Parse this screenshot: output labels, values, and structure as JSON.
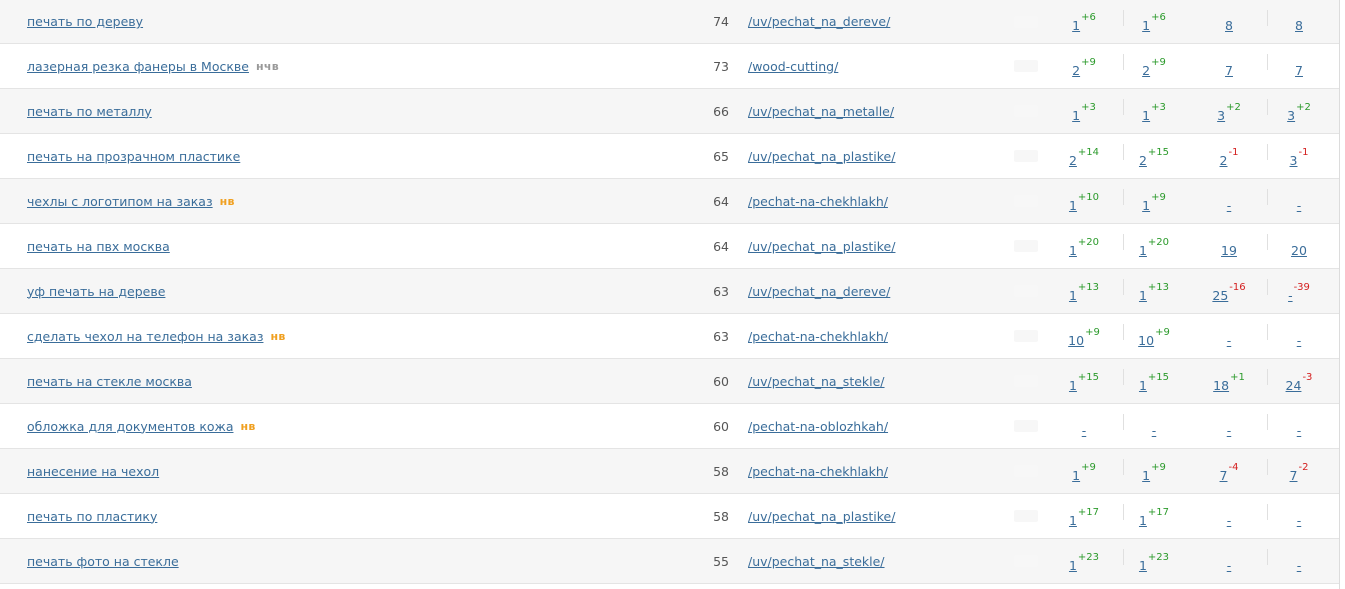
{
  "rows": [
    {
      "keyword": "печать по дереву",
      "badge": "",
      "badge_type": "",
      "freq": "74",
      "url": "/uv/pechat_na_dereve/",
      "p1": "1",
      "c1": "+6",
      "p2": "1",
      "c2": "+6",
      "p3": "8",
      "c3": "",
      "p4": "8",
      "c4": ""
    },
    {
      "keyword": "лазерная резка фанеры в Москве",
      "badge": "нчв",
      "badge_type": "nchv",
      "freq": "73",
      "url": "/wood-cutting/",
      "p1": "2",
      "c1": "+9",
      "p2": "2",
      "c2": "+9",
      "p3": "7",
      "c3": "",
      "p4": "7",
      "c4": ""
    },
    {
      "keyword": "печать по металлу",
      "badge": "",
      "badge_type": "",
      "freq": "66",
      "url": "/uv/pechat_na_metalle/",
      "p1": "1",
      "c1": "+3",
      "p2": "1",
      "c2": "+3",
      "p3": "3",
      "c3": "+2",
      "p4": "3",
      "c4": "+2"
    },
    {
      "keyword": "печать на прозрачном пластике",
      "badge": "",
      "badge_type": "",
      "freq": "65",
      "url": "/uv/pechat_na_plastike/",
      "p1": "2",
      "c1": "+14",
      "p2": "2",
      "c2": "+15",
      "p3": "2",
      "c3": "-1",
      "p4": "3",
      "c4": "-1"
    },
    {
      "keyword": "чехлы с логотипом на заказ",
      "badge": "нв",
      "badge_type": "nv",
      "freq": "64",
      "url": "/pechat-na-chekhlakh/",
      "p1": "1",
      "c1": "+10",
      "p2": "1",
      "c2": "+9",
      "p3": "-",
      "c3": "",
      "p4": "-",
      "c4": ""
    },
    {
      "keyword": "печать на пвх москва",
      "badge": "",
      "badge_type": "",
      "freq": "64",
      "url": "/uv/pechat_na_plastike/",
      "p1": "1",
      "c1": "+20",
      "p2": "1",
      "c2": "+20",
      "p3": "19",
      "c3": "",
      "p4": "20",
      "c4": ""
    },
    {
      "keyword": "уф печать на дереве",
      "badge": "",
      "badge_type": "",
      "freq": "63",
      "url": "/uv/pechat_na_dereve/",
      "p1": "1",
      "c1": "+13",
      "p2": "1",
      "c2": "+13",
      "p3": "25",
      "c3": "-16",
      "p4": "-",
      "c4": "-39"
    },
    {
      "keyword": "сделать чехол на телефон на заказ",
      "badge": "нв",
      "badge_type": "nv",
      "freq": "63",
      "url": "/pechat-na-chekhlakh/",
      "p1": "10",
      "c1": "+9",
      "p2": "10",
      "c2": "+9",
      "p3": "-",
      "c3": "",
      "p4": "-",
      "c4": ""
    },
    {
      "keyword": "печать на стекле москва",
      "badge": "",
      "badge_type": "",
      "freq": "60",
      "url": "/uv/pechat_na_stekle/",
      "p1": "1",
      "c1": "+15",
      "p2": "1",
      "c2": "+15",
      "p3": "18",
      "c3": "+1",
      "p4": "24",
      "c4": "-3"
    },
    {
      "keyword": "обложка для документов кожа",
      "badge": "нв",
      "badge_type": "nv",
      "freq": "60",
      "url": "/pechat-na-oblozhkah/",
      "p1": "-",
      "c1": "",
      "p2": "-",
      "c2": "",
      "p3": "-",
      "c3": "",
      "p4": "-",
      "c4": ""
    },
    {
      "keyword": "нанесение на чехол",
      "badge": "",
      "badge_type": "",
      "freq": "58",
      "url": "/pechat-na-chekhlakh/",
      "p1": "1",
      "c1": "+9",
      "p2": "1",
      "c2": "+9",
      "p3": "7",
      "c3": "-4",
      "p4": "7",
      "c4": "-2"
    },
    {
      "keyword": "печать по пластику",
      "badge": "",
      "badge_type": "",
      "freq": "58",
      "url": "/uv/pechat_na_plastike/",
      "p1": "1",
      "c1": "+17",
      "p2": "1",
      "c2": "+17",
      "p3": "-",
      "c3": "",
      "p4": "-",
      "c4": ""
    },
    {
      "keyword": "печать фото на стекле",
      "badge": "",
      "badge_type": "",
      "freq": "55",
      "url": "/uv/pechat_na_stekle/",
      "p1": "1",
      "c1": "+23",
      "p2": "1",
      "c2": "+23",
      "p3": "-",
      "c3": "",
      "p4": "-",
      "c4": ""
    }
  ],
  "colors": {
    "link": "#3a6d9a",
    "positive_change": "#2b9a2b",
    "negative_change": "#d42020",
    "badge_nv": "#f0a020",
    "badge_nchv": "#999999"
  }
}
